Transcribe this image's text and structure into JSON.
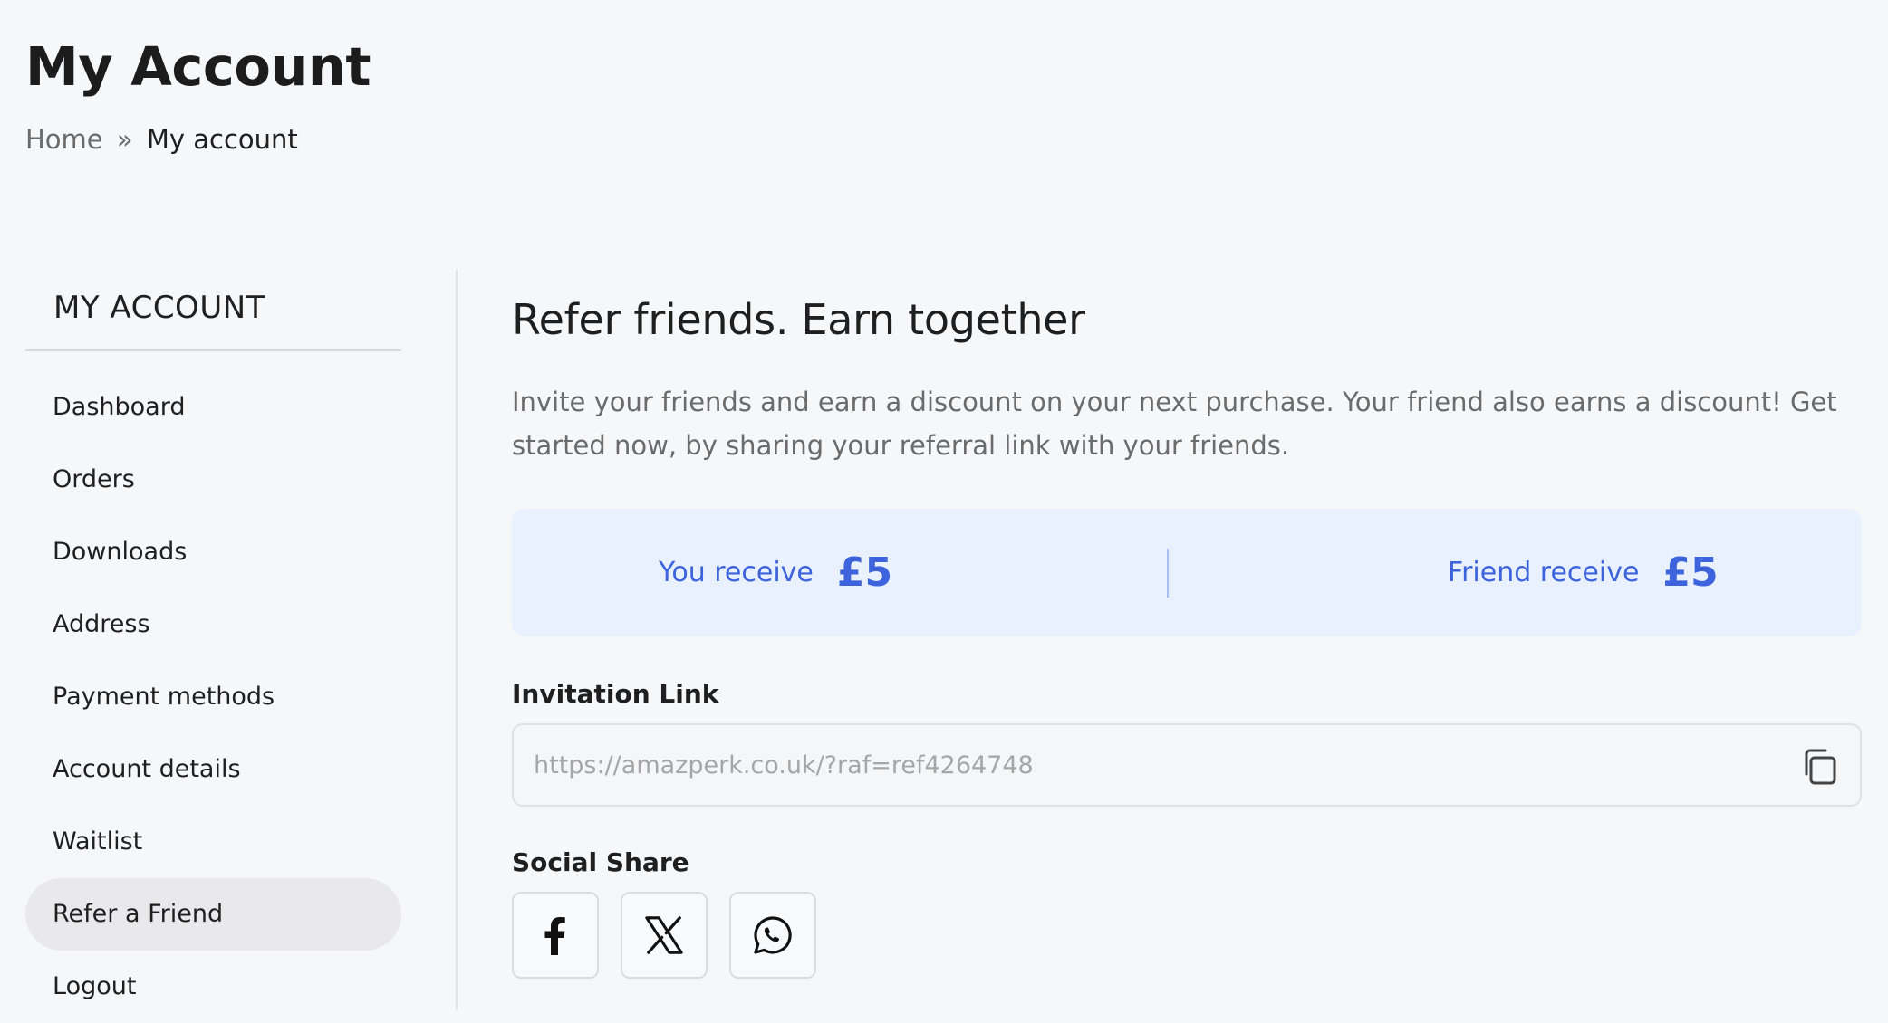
{
  "header": {
    "title": "My Account",
    "breadcrumb": {
      "home": "Home",
      "separator": "»",
      "current": "My account"
    }
  },
  "sidebar": {
    "heading": "MY ACCOUNT",
    "items": [
      {
        "label": "Dashboard",
        "active": false
      },
      {
        "label": "Orders",
        "active": false
      },
      {
        "label": "Downloads",
        "active": false
      },
      {
        "label": "Address",
        "active": false
      },
      {
        "label": "Payment methods",
        "active": false
      },
      {
        "label": "Account details",
        "active": false
      },
      {
        "label": "Waitlist",
        "active": false
      },
      {
        "label": "Refer a Friend",
        "active": true
      },
      {
        "label": "Logout",
        "active": false
      }
    ]
  },
  "main": {
    "heading": "Refer friends. Earn together",
    "description": "Invite your friends and earn a discount on your next purchase. Your friend also earns a discount! Get started now, by sharing your referral link with your friends.",
    "rewards": {
      "you_label": "You receive",
      "you_amount": "£5",
      "friend_label": "Friend receive",
      "friend_amount": "£5"
    },
    "invitation": {
      "label": "Invitation Link",
      "value": "https://amazperk.co.uk/?raf=ref4264748",
      "copy_icon": "copy-icon"
    },
    "social": {
      "label": "Social Share",
      "buttons": [
        {
          "name": "facebook",
          "icon": "facebook-icon"
        },
        {
          "name": "x",
          "icon": "x-icon"
        },
        {
          "name": "whatsapp",
          "icon": "whatsapp-icon"
        }
      ]
    }
  },
  "colors": {
    "accent": "#3d63dd",
    "reward_background": "#e8f1fd",
    "page_background": "#f6f7f9",
    "active_item_background": "#e9e9eb"
  }
}
